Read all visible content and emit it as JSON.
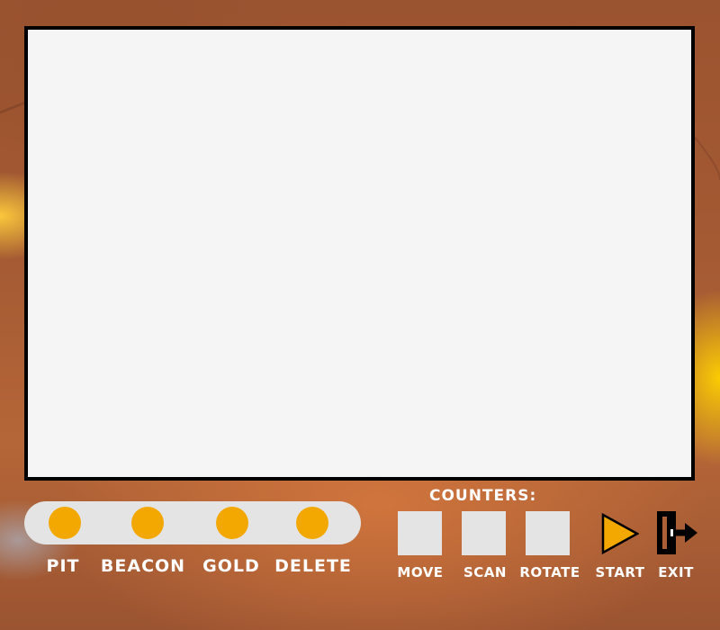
{
  "palette": {
    "items": [
      {
        "label": "PIT",
        "icon": "pit-dot"
      },
      {
        "label": "BEACON",
        "icon": "beacon-dot"
      },
      {
        "label": "GOLD",
        "icon": "gold-dot"
      },
      {
        "label": "DELETE",
        "icon": "delete-dot"
      }
    ],
    "dot_color": "#f2a800"
  },
  "counters": {
    "title": "COUNTERS:",
    "items": [
      {
        "label": "MOVE",
        "value": ""
      },
      {
        "label": "SCAN",
        "value": ""
      },
      {
        "label": "ROTATE",
        "value": ""
      }
    ]
  },
  "controls": {
    "start_label": "START",
    "exit_label": "EXIT",
    "start_icon": "play-triangle-icon",
    "exit_icon": "exit-door-icon",
    "accent": "#f2a800"
  }
}
